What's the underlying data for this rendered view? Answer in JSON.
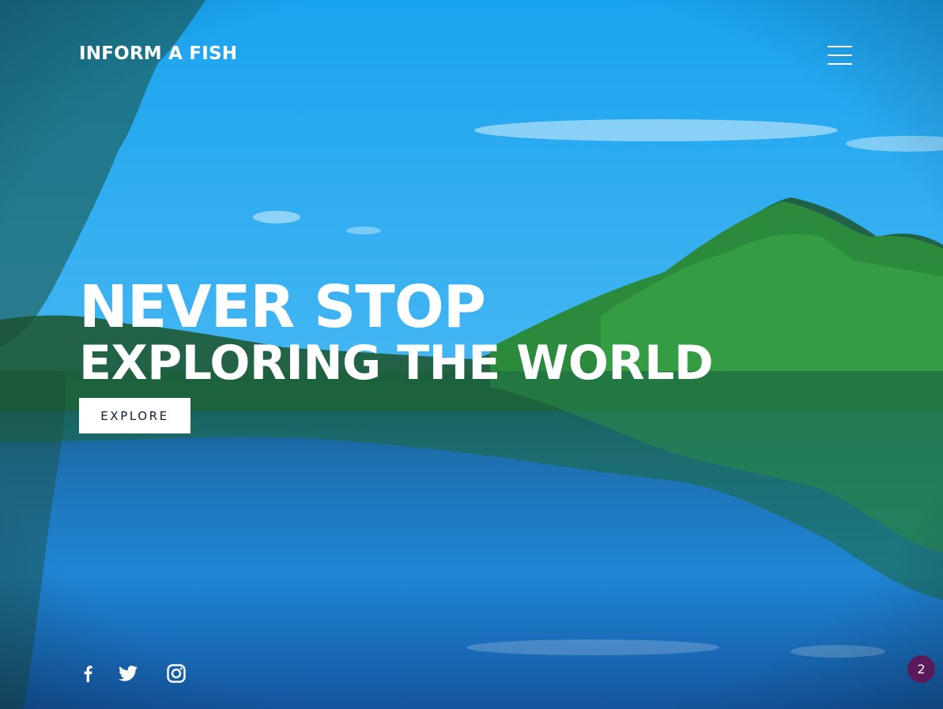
{
  "header": {
    "logo_text": "INFORM A FISH",
    "menu_icon": "hamburger-menu-icon"
  },
  "hero": {
    "headline_line1": "NEVER STOP",
    "headline_line2": "EXPLORING THE WORLD",
    "cta_label": "EXPLORE"
  },
  "social": {
    "icons": [
      "facebook-icon",
      "twitter-icon",
      "instagram-icon"
    ]
  },
  "badge": {
    "count": "2",
    "color": "#5b1a5c"
  },
  "colors": {
    "sky": "#1fa6ef",
    "foliage": "#2f8a3a",
    "water": "#1c7fd0",
    "text": "#ffffff",
    "button_text": "#0b1f3a"
  }
}
